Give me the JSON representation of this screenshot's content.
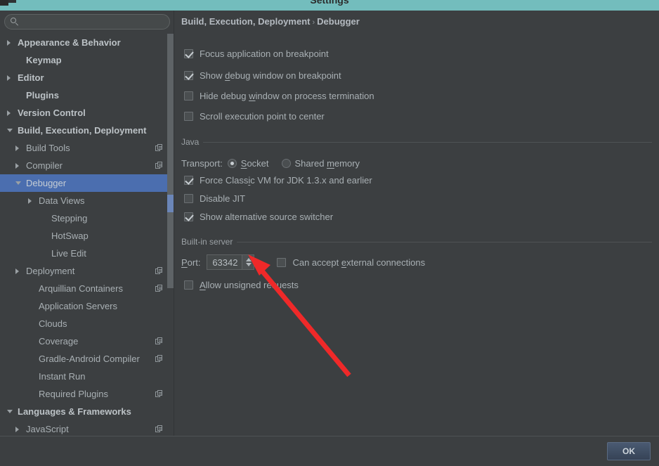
{
  "window": {
    "title": "Settings",
    "titlebar_color": "#73bdbd"
  },
  "search": {
    "value": "",
    "placeholder": "",
    "icon": "search-icon"
  },
  "sidebar": {
    "items": [
      {
        "label": "Appearance & Behavior",
        "indent": 0,
        "arrow": "right",
        "bold": true,
        "selected": false,
        "module_icon": false
      },
      {
        "label": "Keymap",
        "indent": 1,
        "arrow": "none",
        "bold": true,
        "selected": false,
        "module_icon": false
      },
      {
        "label": "Editor",
        "indent": 0,
        "arrow": "right",
        "bold": true,
        "selected": false,
        "module_icon": false
      },
      {
        "label": "Plugins",
        "indent": 1,
        "arrow": "none",
        "bold": true,
        "selected": false,
        "module_icon": false
      },
      {
        "label": "Version Control",
        "indent": 0,
        "arrow": "right",
        "bold": true,
        "selected": false,
        "module_icon": false
      },
      {
        "label": "Build, Execution, Deployment",
        "indent": 0,
        "arrow": "down",
        "bold": true,
        "selected": false,
        "module_icon": false
      },
      {
        "label": "Build Tools",
        "indent": 1,
        "arrow": "right",
        "bold": false,
        "selected": false,
        "module_icon": true
      },
      {
        "label": "Compiler",
        "indent": 1,
        "arrow": "right",
        "bold": false,
        "selected": false,
        "module_icon": true
      },
      {
        "label": "Debugger",
        "indent": 1,
        "arrow": "down",
        "bold": false,
        "selected": true,
        "module_icon": false
      },
      {
        "label": "Data Views",
        "indent": 2,
        "arrow": "right",
        "bold": false,
        "selected": false,
        "module_icon": false
      },
      {
        "label": "Stepping",
        "indent": 3,
        "arrow": "none",
        "bold": false,
        "selected": false,
        "module_icon": false
      },
      {
        "label": "HotSwap",
        "indent": 3,
        "arrow": "none",
        "bold": false,
        "selected": false,
        "module_icon": false
      },
      {
        "label": "Live Edit",
        "indent": 3,
        "arrow": "none",
        "bold": false,
        "selected": false,
        "module_icon": false
      },
      {
        "label": "Deployment",
        "indent": 1,
        "arrow": "right",
        "bold": false,
        "selected": false,
        "module_icon": true
      },
      {
        "label": "Arquillian Containers",
        "indent": 2,
        "arrow": "none",
        "bold": false,
        "selected": false,
        "module_icon": true
      },
      {
        "label": "Application Servers",
        "indent": 2,
        "arrow": "none",
        "bold": false,
        "selected": false,
        "module_icon": false
      },
      {
        "label": "Clouds",
        "indent": 2,
        "arrow": "none",
        "bold": false,
        "selected": false,
        "module_icon": false
      },
      {
        "label": "Coverage",
        "indent": 2,
        "arrow": "none",
        "bold": false,
        "selected": false,
        "module_icon": true
      },
      {
        "label": "Gradle-Android Compiler",
        "indent": 2,
        "arrow": "none",
        "bold": false,
        "selected": false,
        "module_icon": true
      },
      {
        "label": "Instant Run",
        "indent": 2,
        "arrow": "none",
        "bold": false,
        "selected": false,
        "module_icon": false
      },
      {
        "label": "Required Plugins",
        "indent": 2,
        "arrow": "none",
        "bold": false,
        "selected": false,
        "module_icon": true
      },
      {
        "label": "Languages & Frameworks",
        "indent": 0,
        "arrow": "down",
        "bold": true,
        "selected": false,
        "module_icon": false
      },
      {
        "label": "JavaScript",
        "indent": 1,
        "arrow": "right",
        "bold": false,
        "selected": false,
        "module_icon": true
      }
    ]
  },
  "main": {
    "breadcrumb": {
      "root": "Build, Execution, Deployment",
      "separator": "›",
      "leaf": "Debugger"
    },
    "general_options": [
      {
        "label_pre": "Focus application on breakpoint",
        "mnemonic": "",
        "label_post": "",
        "checked": true
      },
      {
        "label_pre": "Show ",
        "mnemonic": "d",
        "label_post": "ebug window on breakpoint",
        "checked": true
      },
      {
        "label_pre": "Hide debug ",
        "mnemonic": "w",
        "label_post": "indow on process termination",
        "checked": false
      },
      {
        "label_pre": "Scroll execution point to center",
        "mnemonic": "",
        "label_post": "",
        "checked": false
      }
    ],
    "java_group": {
      "title": "Java",
      "transport_label": "Transport:",
      "transport_options": [
        {
          "label_pre": "",
          "mnemonic": "S",
          "label_post": "ocket",
          "selected": true
        },
        {
          "label_pre": "Shared ",
          "mnemonic": "m",
          "label_post": "emory",
          "selected": false
        }
      ],
      "checkboxes": [
        {
          "label_pre": "Force Class",
          "mnemonic": "i",
          "label_post": "c VM for JDK 1.3.x and earlier",
          "checked": true
        },
        {
          "label_pre": "Disable JIT",
          "mnemonic": "",
          "label_post": "",
          "checked": false
        },
        {
          "label_pre": "Show alternative source switcher",
          "mnemonic": "",
          "label_post": "",
          "checked": true
        }
      ]
    },
    "builtin_server_group": {
      "title": "Built-in server",
      "port_label_pre": "",
      "port_label_mnemonic": "P",
      "port_label_post": "ort:",
      "port_value": "63342",
      "external_conn": {
        "label_pre": "Can accept ",
        "mnemonic": "e",
        "label_post": "xternal connections",
        "checked": false
      },
      "allow_unsigned": {
        "label_pre": "",
        "mnemonic": "A",
        "label_post": "llow unsigned requests",
        "checked": false
      }
    }
  },
  "footer": {
    "ok_label": "OK"
  },
  "annotation": {
    "arrow_color": "#ef2929",
    "points_to": "port-spinner"
  }
}
